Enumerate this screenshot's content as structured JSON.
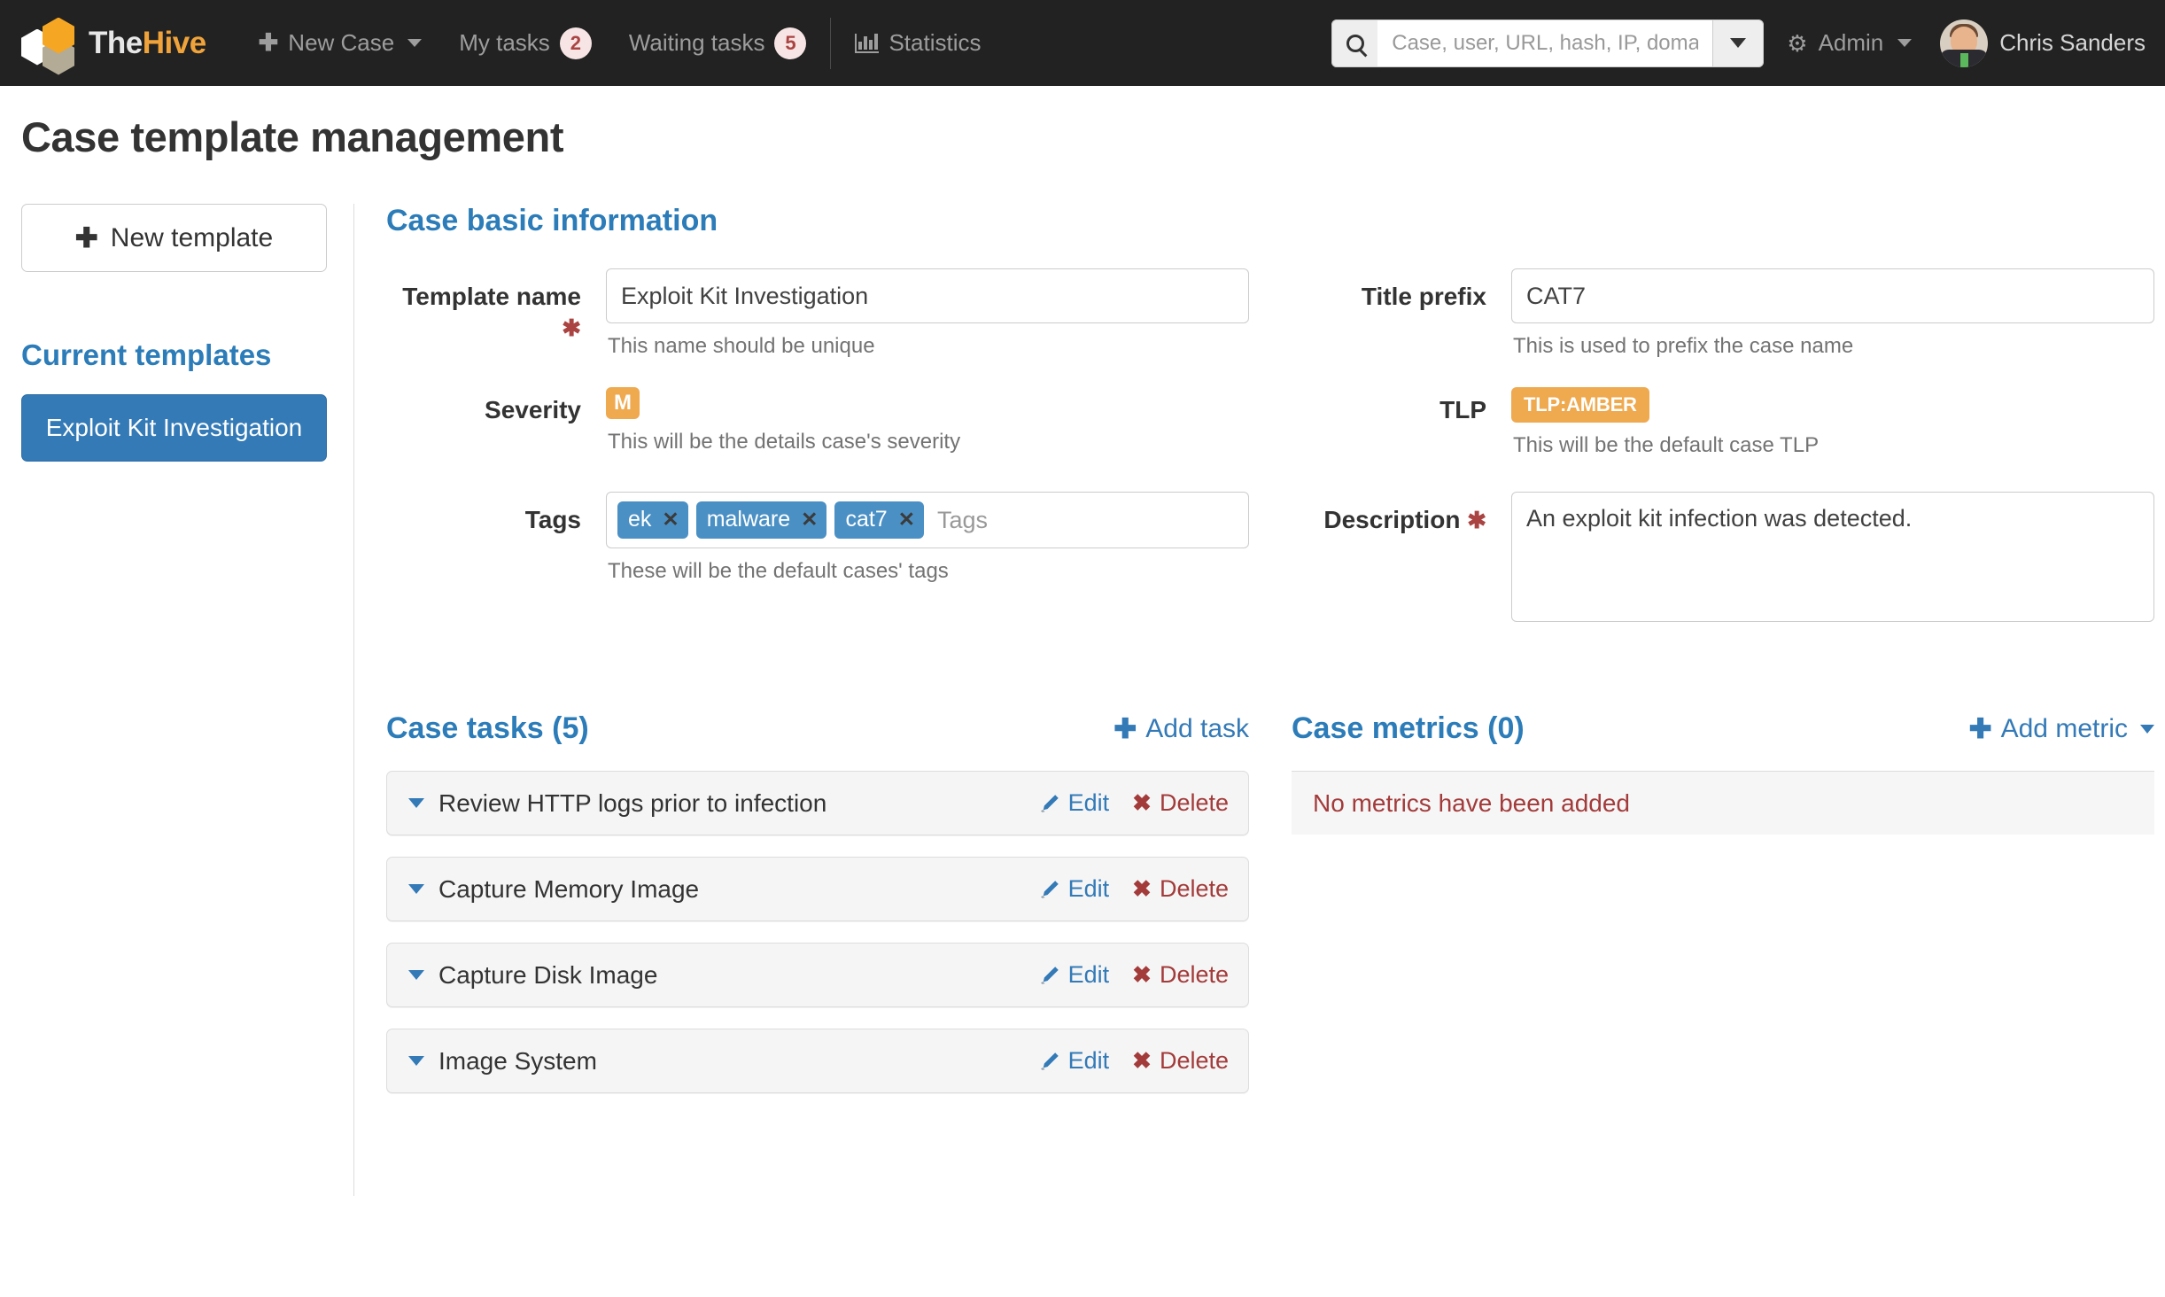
{
  "navbar": {
    "brand_the": "The",
    "brand_hive": "Hive",
    "new_case_label": "New Case",
    "my_tasks_label": "My tasks",
    "my_tasks_count": "2",
    "waiting_tasks_label": "Waiting tasks",
    "waiting_tasks_count": "5",
    "statistics_label": "Statistics",
    "admin_label": "Admin",
    "user_name": "Chris Sanders",
    "search": {
      "placeholder": "Case, user, URL, hash, IP, domain ..",
      "value": ""
    }
  },
  "page": {
    "title": "Case template management"
  },
  "sidebar": {
    "new_template_label": "New template",
    "current_templates_heading": "Current templates",
    "templates": [
      {
        "label": "Exploit Kit Investigation",
        "selected": true
      }
    ]
  },
  "basic_info": {
    "section_title": "Case basic information",
    "template_name": {
      "label": "Template name",
      "required": "✱",
      "value": "Exploit Kit Investigation",
      "placeholder": "",
      "help": "This name should be unique"
    },
    "title_prefix": {
      "label": "Title prefix",
      "value": "CAT7",
      "placeholder": "",
      "help": "This is used to prefix the case name"
    },
    "severity": {
      "label": "Severity",
      "badge": "M",
      "badge_color": "#efa94f",
      "help": "This will be the details case's severity"
    },
    "tlp": {
      "label": "TLP",
      "badge": "TLP:AMBER",
      "badge_color": "#efa94f",
      "help": "This will be the default case TLP"
    },
    "tags": {
      "label": "Tags",
      "chips": [
        "ek",
        "malware",
        "cat7"
      ],
      "placeholder": "Tags",
      "help": "These will be the default cases' tags",
      "chip_color": "#4a90c4"
    },
    "description": {
      "label": "Description",
      "required": "✱",
      "value": "An exploit kit infection was detected.",
      "placeholder": ""
    }
  },
  "case_tasks": {
    "title": "Case tasks (5)",
    "add_label": "Add task",
    "edit_label": "Edit",
    "delete_label": "Delete",
    "rows": [
      {
        "name": "Review HTTP logs prior to infection"
      },
      {
        "name": "Capture Memory Image"
      },
      {
        "name": "Capture Disk Image"
      },
      {
        "name": "Image System"
      }
    ]
  },
  "case_metrics": {
    "title": "Case metrics (0)",
    "add_label": "Add metric",
    "empty_message": "No metrics have been added"
  }
}
